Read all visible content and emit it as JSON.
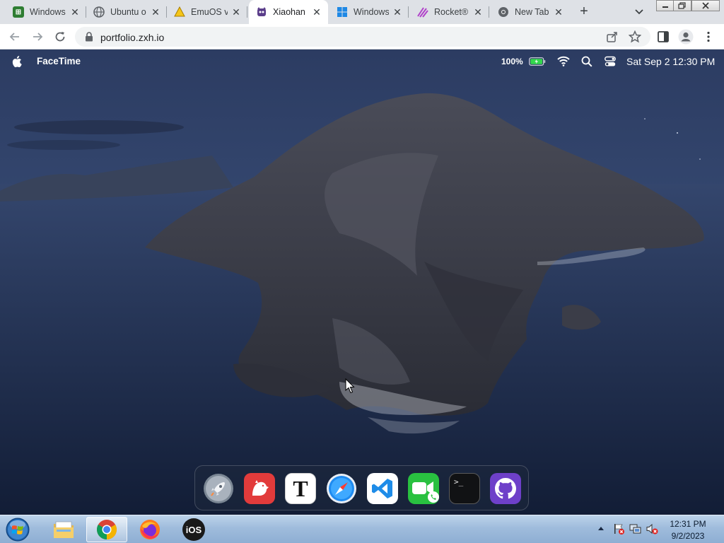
{
  "browser": {
    "tabs": [
      {
        "title": "Windows",
        "icon": "windows-emulator-favicon",
        "active": false
      },
      {
        "title": "Ubuntu o",
        "icon": "globe-favicon",
        "active": false
      },
      {
        "title": "EmuOS v",
        "icon": "emuos-favicon",
        "active": false
      },
      {
        "title": "Xiaohan",
        "icon": "xiaohan-favicon",
        "active": true
      },
      {
        "title": "Windows",
        "icon": "windows-favicon",
        "active": false
      },
      {
        "title": "Rocket®",
        "icon": "rocket-favicon",
        "active": false
      },
      {
        "title": "New Tab",
        "icon": "chrome-favicon",
        "active": false
      }
    ],
    "tab_close_glyph": "✕",
    "new_tab_glyph": "+",
    "url": "portfolio.zxh.io"
  },
  "macos": {
    "app_name": "FaceTime",
    "battery_percent": "100%",
    "clock": "Sat Sep 2 12:30 PM",
    "dock": [
      {
        "name": "launchpad",
        "icon": "rocket-icon"
      },
      {
        "name": "bear",
        "icon": "bear-icon"
      },
      {
        "name": "typora",
        "icon": "typora-icon",
        "glyph": "T"
      },
      {
        "name": "safari",
        "icon": "compass-icon"
      },
      {
        "name": "vscode",
        "icon": "vscode-icon"
      },
      {
        "name": "facetime",
        "icon": "facetime-icon"
      },
      {
        "name": "terminal",
        "icon": "terminal-icon",
        "glyph": ">_"
      },
      {
        "name": "github",
        "icon": "github-icon"
      }
    ]
  },
  "taskbar": {
    "apps": [
      {
        "name": "explorer",
        "icon": "folder-icon"
      },
      {
        "name": "chrome",
        "icon": "chrome-icon",
        "active": true
      },
      {
        "name": "firefox",
        "icon": "firefox-icon"
      },
      {
        "name": "ios",
        "icon": "ios-icon",
        "glyph": "iOS"
      }
    ],
    "time": "12:31 PM",
    "date": "9/2/2023"
  },
  "colors": {
    "tabstrip": "#dee1e6",
    "desktop_sea": "#1a2846",
    "taskbar": "#9fbcdc"
  }
}
